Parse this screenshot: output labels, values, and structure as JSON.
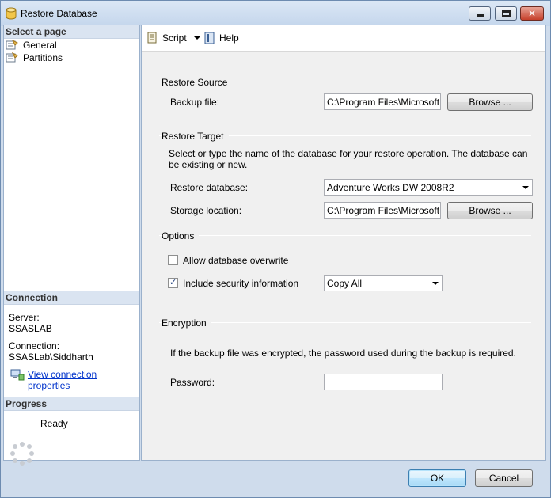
{
  "window": {
    "title": "Restore Database",
    "accent": "#cfdcec"
  },
  "left_pane": {
    "select_page_header": "Select a page",
    "pages": [
      {
        "label": "General",
        "icon": "page-icon"
      },
      {
        "label": "Partitions",
        "icon": "page-icon"
      }
    ],
    "connection_header": "Connection",
    "server_label": "Server:",
    "server_value": "SSASLAB",
    "connection_label": "Connection:",
    "connection_value": "SSASLab\\Siddharth",
    "view_connection_link": "View connection properties",
    "progress_header": "Progress",
    "progress_status": "Ready"
  },
  "toolbar": {
    "script_label": "Script",
    "help_label": "Help"
  },
  "restore_source": {
    "group_label": "Restore Source",
    "backup_file_label": "Backup file:",
    "backup_file_value": "C:\\Program Files\\Microsoft SQ",
    "browse_label": "Browse ..."
  },
  "restore_target": {
    "group_label": "Restore Target",
    "description": "Select or type the name of the database for your restore operation. The database can be existing or new.",
    "restore_database_label": "Restore database:",
    "restore_database_value": "Adventure Works DW 2008R2",
    "storage_location_label": "Storage location:",
    "storage_location_value": "C:\\Program Files\\Microsoft SQ",
    "browse_label": "Browse ..."
  },
  "options": {
    "group_label": "Options",
    "allow_overwrite_label": "Allow database overwrite",
    "allow_overwrite_checked": false,
    "include_security_label": "Include security information",
    "include_security_checked": true,
    "security_mode_value": "Copy All"
  },
  "encryption": {
    "group_label": "Encryption",
    "description": "If the backup file was encrypted, the password used during the backup is required.",
    "password_label": "Password:",
    "password_value": ""
  },
  "buttons": {
    "ok_label": "OK",
    "cancel_label": "Cancel"
  }
}
